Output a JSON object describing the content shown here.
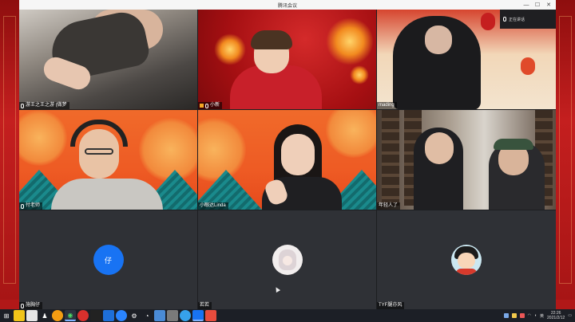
{
  "window": {
    "title": "腾讯会议"
  },
  "participants": [
    {
      "name": "游王之王之游 (做梦",
      "tile": "video"
    },
    {
      "name": "小新",
      "tile": "video",
      "badge": "host"
    },
    {
      "name": "mading",
      "tile": "video"
    },
    {
      "name": "付老师",
      "tile": "video"
    },
    {
      "name": "小眼达Linda",
      "tile": "video"
    },
    {
      "name": "年轻人了",
      "tile": "video"
    },
    {
      "name": "施胸仔",
      "tile": "avatar",
      "avatar_text": "仔"
    },
    {
      "name": "若若",
      "tile": "avatar"
    },
    {
      "name": "TYF腿亦风",
      "tile": "avatar"
    }
  ],
  "overlay_box": {
    "label": "正在讲话"
  },
  "taskbar": {
    "tray": {
      "lang": "英",
      "time": "22:26",
      "date": "2021/2/12"
    }
  },
  "colors": {
    "accent": "#1873f3",
    "desktop": "#b11818",
    "meeting_bg": "#2b2d31"
  }
}
